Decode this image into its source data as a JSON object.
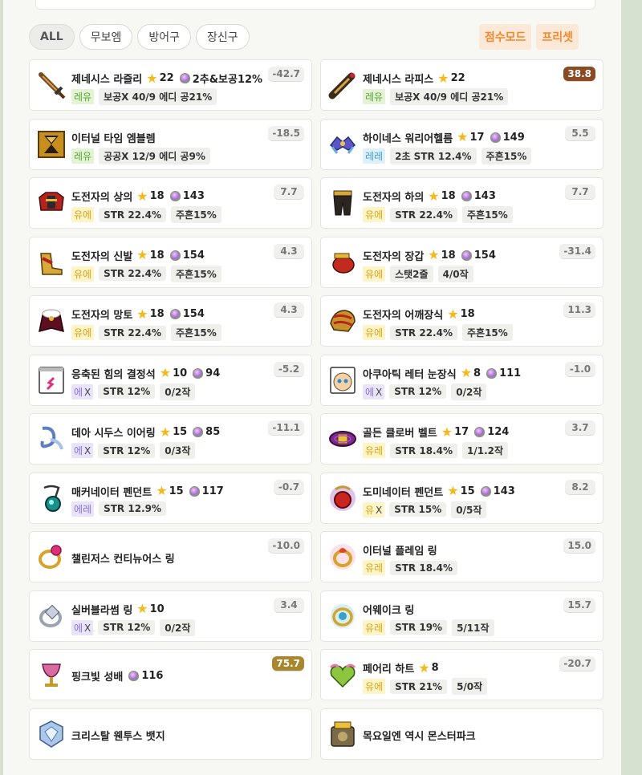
{
  "filters": {
    "tabs": [
      "ALL",
      "무보엠",
      "방어구",
      "장신구"
    ],
    "active": "ALL",
    "score_mode": "점수모드",
    "preset": "프리셋"
  },
  "colors": {
    "brand_orange": "#f08a2e",
    "bg": "#d7e1cf",
    "score_high_brown": "#8a4a22",
    "score_high_gold": "#a8872e"
  },
  "items": [
    {
      "name": "제네시스 라즐리",
      "star": "22",
      "frag": "2추&보공12%",
      "pot": "레유",
      "pot_class": "legend",
      "tags": [
        "보공X 40/9 에디 공21%"
      ],
      "score": "-42.7",
      "icon": "sword-icon"
    },
    {
      "name": "제네시스 라피스",
      "star": "22",
      "frag": "",
      "pot": "레유",
      "pot_class": "legend",
      "tags": [
        "보공X 40/9 에디 공21%"
      ],
      "score": "38.8",
      "score_color": "#8a4a22",
      "icon": "claw-weapon-icon"
    },
    {
      "name": "이터널 타임 엠블렘",
      "star": "",
      "frag": "",
      "pot": "레유",
      "pot_class": "legend",
      "tags": [
        "공공X 12/9 에디 공9%"
      ],
      "score": "-18.5",
      "icon": "emblem-icon"
    },
    {
      "name": "하이네스 워리어헬름",
      "star": "17",
      "frag": "149",
      "pot": "레레",
      "pot_class": "rare",
      "tags": [
        "2초 STR 12.4%",
        "주흔15%"
      ],
      "score": "5.5",
      "icon": "helmet-icon"
    },
    {
      "name": "도전자의 상의",
      "star": "18",
      "frag": "143",
      "pot": "유에",
      "pot_class": "unique",
      "tags": [
        "STR 22.4%",
        "주흔15%"
      ],
      "score": "7.7",
      "icon": "top-armor-icon"
    },
    {
      "name": "도전자의 하의",
      "star": "18",
      "frag": "143",
      "pot": "유에",
      "pot_class": "unique",
      "tags": [
        "STR 22.4%",
        "주흔15%"
      ],
      "score": "7.7",
      "icon": "pants-icon"
    },
    {
      "name": "도전자의 신발",
      "star": "18",
      "frag": "154",
      "pot": "유에",
      "pot_class": "unique",
      "tags": [
        "STR 22.4%",
        "주흔15%"
      ],
      "score": "4.3",
      "icon": "shoes-icon"
    },
    {
      "name": "도전자의 장갑",
      "star": "18",
      "frag": "154",
      "pot": "유에",
      "pot_class": "unique",
      "tags": [
        "스탯2줄",
        "4/0작"
      ],
      "score": "-31.4",
      "icon": "gloves-icon"
    },
    {
      "name": "도전자의 망토",
      "star": "18",
      "frag": "154",
      "pot": "유에",
      "pot_class": "unique",
      "tags": [
        "STR 22.4%",
        "주흔15%"
      ],
      "score": "4.3",
      "icon": "cape-icon"
    },
    {
      "name": "도전자의 어깨장식",
      "star": "18",
      "frag": "",
      "pot": "유에",
      "pot_class": "unique",
      "tags": [
        "STR 22.4%",
        "주흔15%"
      ],
      "score": "11.3",
      "icon": "shoulder-icon"
    },
    {
      "name": "응축된 힘의 결정석",
      "star": "10",
      "frag": "94",
      "pot": "에",
      "pot_x": "X",
      "pot_class": "epic",
      "tags": [
        "STR 12%",
        "0/2작"
      ],
      "score": "-5.2",
      "icon": "crystal-pocket-icon"
    },
    {
      "name": "아쿠아틱 레터 눈장식",
      "star": "8",
      "frag": "111",
      "pot": "에",
      "pot_x": "X",
      "pot_class": "epic",
      "tags": [
        "STR 12%",
        "0/2작"
      ],
      "score": "-1.0",
      "icon": "eye-accessory-icon"
    },
    {
      "name": "데아 시두스 이어링",
      "star": "15",
      "frag": "85",
      "pot": "에",
      "pot_x": "X",
      "pot_class": "epic",
      "tags": [
        "STR 12%",
        "0/3작"
      ],
      "score": "-11.1",
      "icon": "earring-icon"
    },
    {
      "name": "골든 클로버 벨트",
      "star": "17",
      "frag": "124",
      "pot": "유레",
      "pot_class": "unique",
      "tags": [
        "STR 18.4%",
        "1/1.2작"
      ],
      "score": "3.7",
      "icon": "belt-icon"
    },
    {
      "name": "매커네이터 펜던트",
      "star": "15",
      "frag": "117",
      "pot": "에레",
      "pot_class": "epic",
      "tags": [
        "STR 12.9%"
      ],
      "score": "-0.7",
      "icon": "pendant-icon"
    },
    {
      "name": "도미네이터 펜던트",
      "star": "15",
      "frag": "143",
      "pot": "유",
      "pot_x": "X",
      "pot_class": "unique",
      "tags": [
        "STR 15%",
        "0/5작"
      ],
      "score": "8.2",
      "icon": "dominator-pendant-icon"
    },
    {
      "name": "챌린저스 컨티뉴어스 링",
      "star": "",
      "frag": "",
      "pot": "",
      "pot_class": "",
      "tags": [],
      "score": "-10.0",
      "icon": "ring-icon"
    },
    {
      "name": "이터널 플레임 링",
      "star": "",
      "frag": "",
      "pot": "유레",
      "pot_class": "unique",
      "tags": [
        "STR 18.4%"
      ],
      "score": "15.0",
      "icon": "flame-ring-icon"
    },
    {
      "name": "실버블라썸 링",
      "star": "10",
      "frag": "",
      "pot": "에",
      "pot_x": "X",
      "pot_class": "epic",
      "tags": [
        "STR 12%",
        "0/2작"
      ],
      "score": "3.4",
      "icon": "silver-ring-icon"
    },
    {
      "name": "어웨이크 링",
      "star": "",
      "frag": "",
      "pot": "유레",
      "pot_class": "unique",
      "tags": [
        "STR 19%",
        "5/11작"
      ],
      "score": "15.7",
      "icon": "awake-ring-icon"
    },
    {
      "name": "핑크빛 성배",
      "star": "",
      "frag": "116",
      "pot": "",
      "pot_class": "",
      "tags": [],
      "score": "75.7",
      "score_color": "#a8872e",
      "icon": "grail-icon"
    },
    {
      "name": "페어리 하트",
      "star": "8",
      "frag": "",
      "pot": "유에",
      "pot_class": "unique",
      "tags": [
        "STR 21%",
        "5/0작"
      ],
      "score": "-20.7",
      "icon": "fairy-heart-icon"
    },
    {
      "name": "크리스탈 웬투스 뱃지",
      "star": "",
      "frag": "",
      "pot": "",
      "pot_class": "",
      "tags": [],
      "score": "",
      "icon": "badge-icon"
    },
    {
      "name": "목요일엔 역시 몬스터파크",
      "star": "",
      "frag": "",
      "pot": "",
      "pot_class": "",
      "tags": [],
      "score": "",
      "icon": "medal-icon"
    }
  ]
}
